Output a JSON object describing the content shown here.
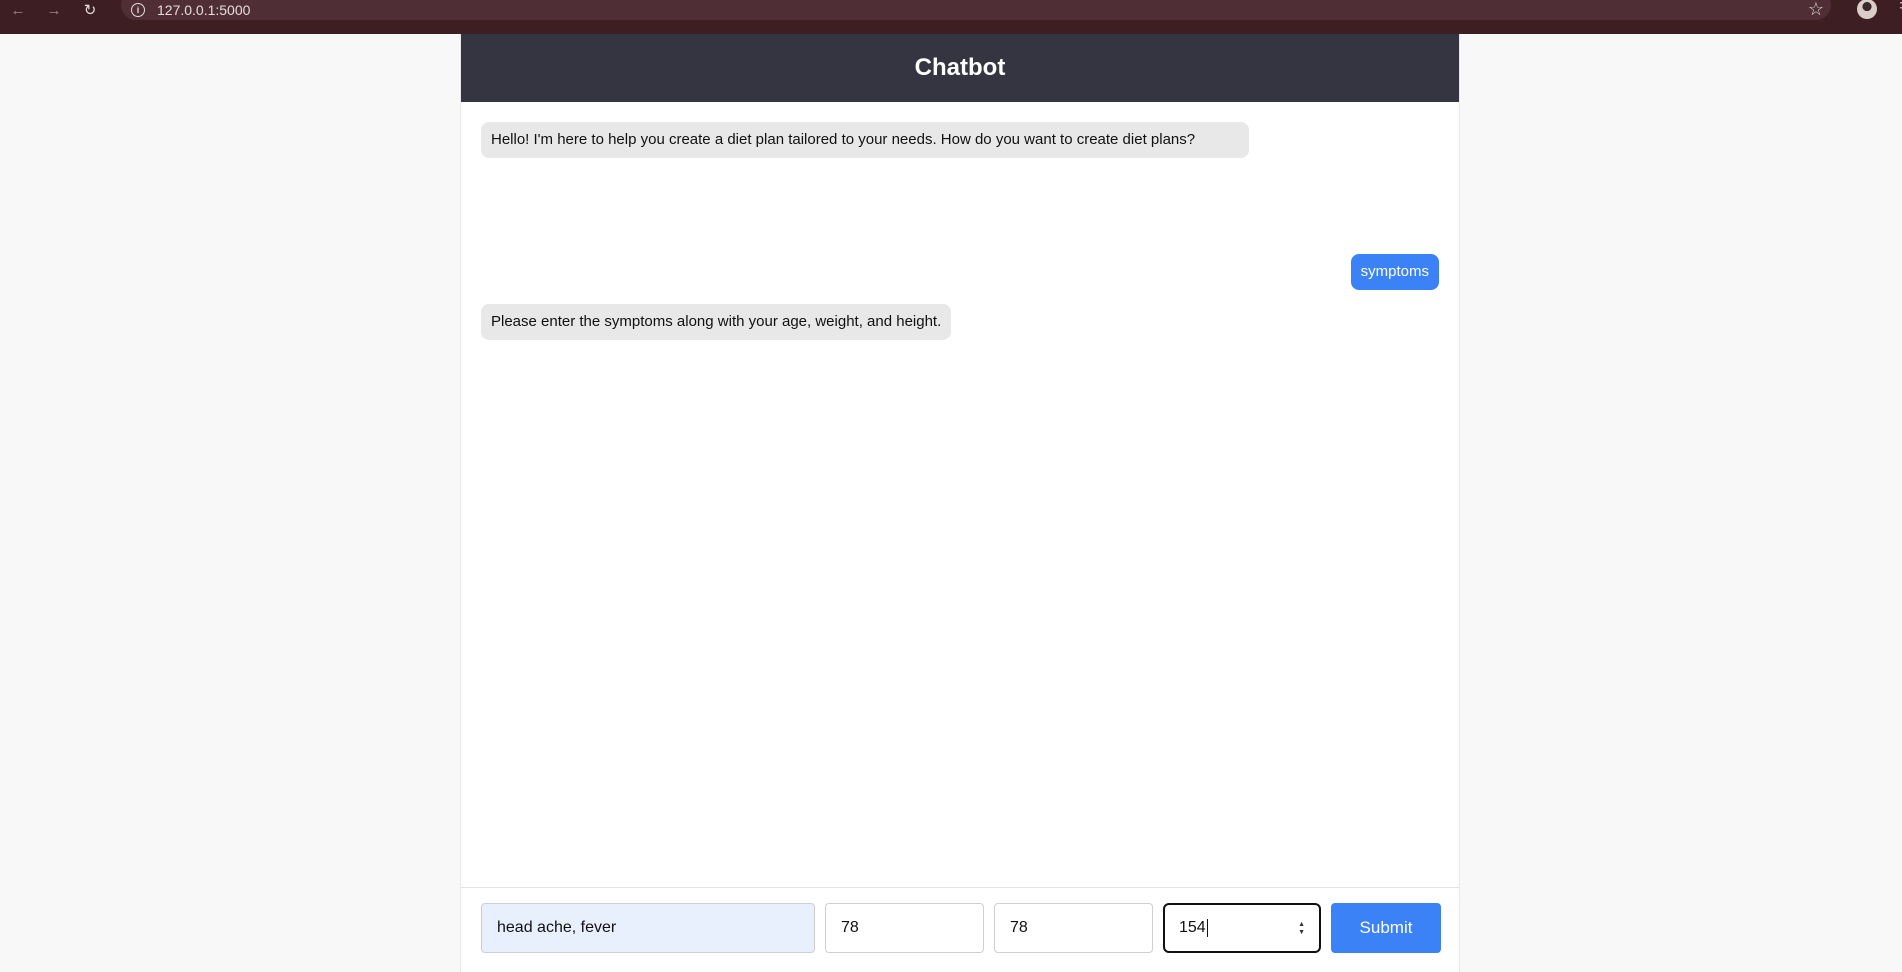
{
  "browser": {
    "url": "127.0.0.1:5000",
    "back_icon": "←",
    "forward_icon": "→",
    "reload_icon": "↻",
    "info_icon": "i",
    "star_icon": "☆",
    "menu_icon": "⋮"
  },
  "app": {
    "title": "Chatbot"
  },
  "chat": {
    "messages": [
      {
        "role": "bot",
        "text": "Hello! I'm here to help you create a diet plan tailored to your needs. How do you want to create diet plans?"
      },
      {
        "role": "user",
        "text": "symptoms"
      },
      {
        "role": "bot",
        "text": "Please enter the symptoms along with your age, weight, and height."
      }
    ]
  },
  "form": {
    "symptoms_value": "head ache, fever",
    "age_value": "78",
    "weight_value": "78",
    "height_value": "154",
    "submit_label": "Submit"
  },
  "colors": {
    "browser_bar": "#3c1e23",
    "header_bg": "#343541",
    "user_bubble": "#3b82f6",
    "bot_bubble": "#e8e8e8",
    "submit_bg": "#3b82f6"
  }
}
